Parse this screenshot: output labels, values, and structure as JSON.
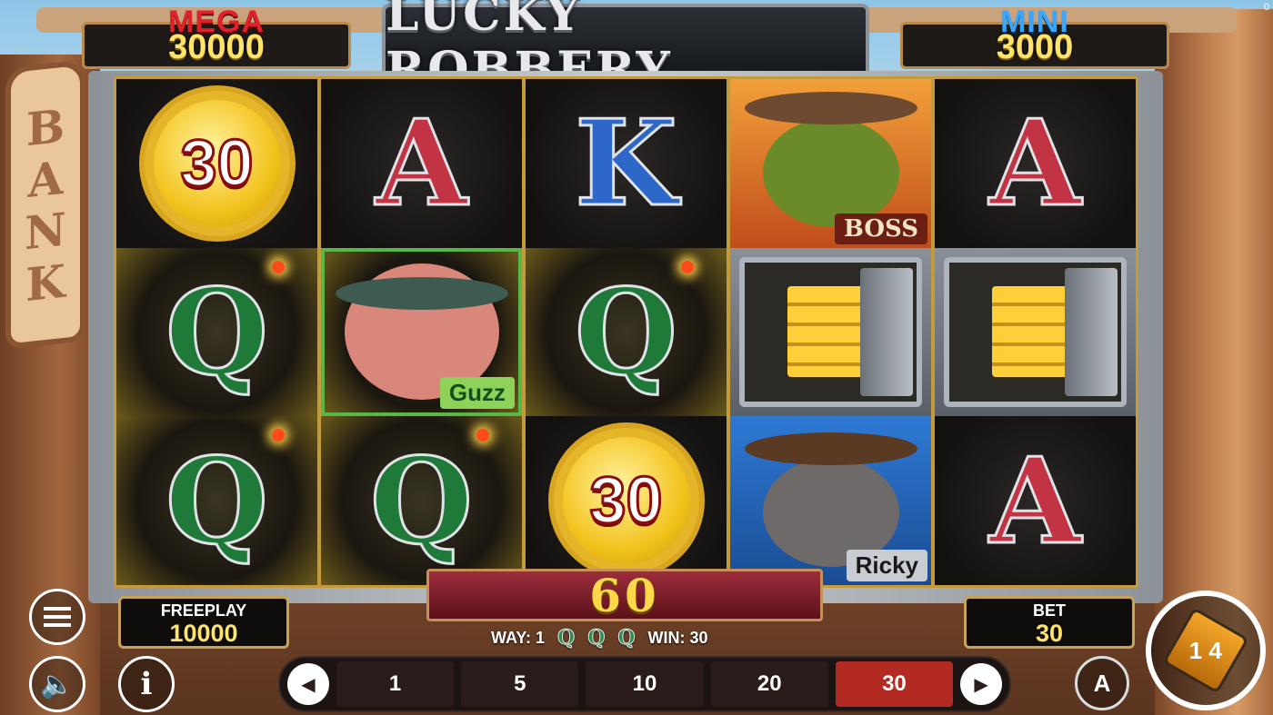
{
  "jackpots": {
    "mega": {
      "label": "MEGA",
      "value": "30000"
    },
    "mini": {
      "label": "MINI",
      "value": "3000"
    }
  },
  "logo": {
    "title": "LUCKY ROBBERY"
  },
  "background": {
    "bank_sign": "BANK"
  },
  "corner_counter": "0",
  "reels": [
    [
      {
        "type": "coin",
        "value": "30"
      },
      {
        "type": "letter",
        "symbol": "Q",
        "highlight": true
      },
      {
        "type": "letter",
        "symbol": "Q",
        "highlight": true
      }
    ],
    [
      {
        "type": "letter",
        "symbol": "A",
        "highlight": false
      },
      {
        "type": "character",
        "name": "Guzz",
        "highlight": true
      },
      {
        "type": "letter",
        "symbol": "Q",
        "highlight": true
      }
    ],
    [
      {
        "type": "letter",
        "symbol": "K",
        "highlight": false
      },
      {
        "type": "letter",
        "symbol": "Q",
        "highlight": true
      },
      {
        "type": "coin",
        "value": "30"
      }
    ],
    [
      {
        "type": "character",
        "name": "BOSS",
        "highlight": false
      },
      {
        "type": "vault",
        "highlight": false
      },
      {
        "type": "character",
        "name": "Ricky",
        "highlight": false
      }
    ],
    [
      {
        "type": "letter",
        "symbol": "A",
        "highlight": false
      },
      {
        "type": "vault",
        "highlight": false
      },
      {
        "type": "letter",
        "symbol": "A",
        "highlight": false
      }
    ]
  ],
  "win_banner": {
    "value": "60"
  },
  "freeplay": {
    "label": "FREEPLAY",
    "value": "10000"
  },
  "bet": {
    "label": "BET",
    "value": "30"
  },
  "win_line": {
    "way_label": "WAY: 1",
    "symbols": [
      "Q",
      "Q",
      "Q"
    ],
    "win_label": "WIN: 30"
  },
  "bet_options": {
    "values": [
      "1",
      "5",
      "10",
      "20",
      "30"
    ],
    "selected": "30",
    "prev_icon": "◀",
    "next_icon": "▶"
  },
  "controls": {
    "menu_icon": "hamburger-menu-icon",
    "sound_icon": "speaker-icon",
    "info_icon": "info-icon",
    "info_glyph": "i",
    "sound_glyph": "🔈",
    "auto_glyph": "A",
    "spin_glyph": "1 4"
  },
  "colors": {
    "mega": "#e0202a",
    "mini": "#39a7ff",
    "jackpot_value": "#ffe36a",
    "bet_active": "#b32a22",
    "reel_border": "#c49a3a"
  }
}
